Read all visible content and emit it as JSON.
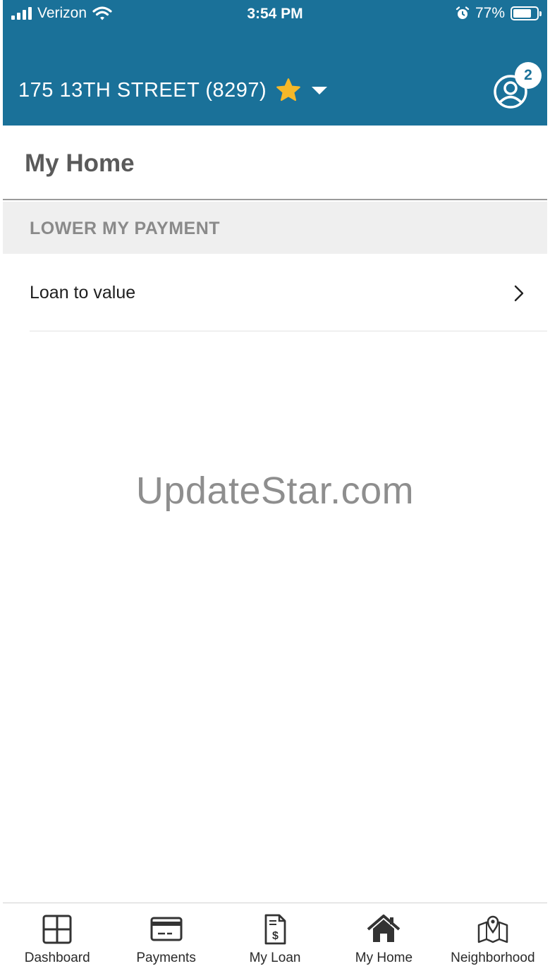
{
  "status_bar": {
    "carrier": "Verizon",
    "time": "3:54 PM",
    "battery": "77%",
    "battery_level": 0.77
  },
  "header": {
    "address": "175 13TH STREET (8297)",
    "favorite_icon": "star-icon",
    "dropdown_icon": "caret-down-icon",
    "profile_icon": "user-circle-icon",
    "notification_count": "2"
  },
  "page": {
    "title": "My Home"
  },
  "section": {
    "label": "LOWER MY PAYMENT",
    "items": [
      {
        "label": "Loan to value",
        "icon": "chevron-right-icon"
      }
    ]
  },
  "watermark": "UpdateStar.com",
  "tabs": [
    {
      "label": "Dashboard",
      "icon": "grid-icon"
    },
    {
      "label": "Payments",
      "icon": "credit-card-icon"
    },
    {
      "label": "My Loan",
      "icon": "document-dollar-icon"
    },
    {
      "label": "My Home",
      "icon": "home-icon"
    },
    {
      "label": "Neighborhood",
      "icon": "map-pin-icon"
    }
  ],
  "colors": {
    "brand": "#1a7199",
    "star": "#f5b829",
    "section_bg": "#efefef"
  }
}
